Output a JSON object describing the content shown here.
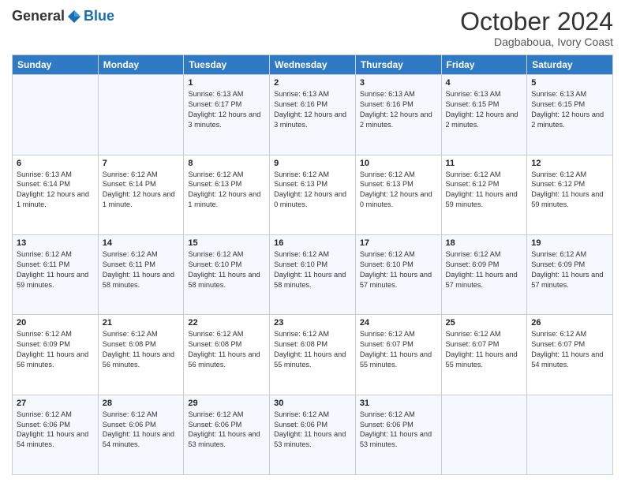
{
  "logo": {
    "general": "General",
    "blue": "Blue"
  },
  "header": {
    "month": "October 2024",
    "location": "Dagbaboua, Ivory Coast"
  },
  "days_of_week": [
    "Sunday",
    "Monday",
    "Tuesday",
    "Wednesday",
    "Thursday",
    "Friday",
    "Saturday"
  ],
  "weeks": [
    [
      {
        "day": "",
        "sunrise": "",
        "sunset": "",
        "daylight": ""
      },
      {
        "day": "",
        "sunrise": "",
        "sunset": "",
        "daylight": ""
      },
      {
        "day": "1",
        "sunrise": "Sunrise: 6:13 AM",
        "sunset": "Sunset: 6:17 PM",
        "daylight": "Daylight: 12 hours and 3 minutes."
      },
      {
        "day": "2",
        "sunrise": "Sunrise: 6:13 AM",
        "sunset": "Sunset: 6:16 PM",
        "daylight": "Daylight: 12 hours and 3 minutes."
      },
      {
        "day": "3",
        "sunrise": "Sunrise: 6:13 AM",
        "sunset": "Sunset: 6:16 PM",
        "daylight": "Daylight: 12 hours and 2 minutes."
      },
      {
        "day": "4",
        "sunrise": "Sunrise: 6:13 AM",
        "sunset": "Sunset: 6:15 PM",
        "daylight": "Daylight: 12 hours and 2 minutes."
      },
      {
        "day": "5",
        "sunrise": "Sunrise: 6:13 AM",
        "sunset": "Sunset: 6:15 PM",
        "daylight": "Daylight: 12 hours and 2 minutes."
      }
    ],
    [
      {
        "day": "6",
        "sunrise": "Sunrise: 6:13 AM",
        "sunset": "Sunset: 6:14 PM",
        "daylight": "Daylight: 12 hours and 1 minute."
      },
      {
        "day": "7",
        "sunrise": "Sunrise: 6:12 AM",
        "sunset": "Sunset: 6:14 PM",
        "daylight": "Daylight: 12 hours and 1 minute."
      },
      {
        "day": "8",
        "sunrise": "Sunrise: 6:12 AM",
        "sunset": "Sunset: 6:13 PM",
        "daylight": "Daylight: 12 hours and 1 minute."
      },
      {
        "day": "9",
        "sunrise": "Sunrise: 6:12 AM",
        "sunset": "Sunset: 6:13 PM",
        "daylight": "Daylight: 12 hours and 0 minutes."
      },
      {
        "day": "10",
        "sunrise": "Sunrise: 6:12 AM",
        "sunset": "Sunset: 6:13 PM",
        "daylight": "Daylight: 12 hours and 0 minutes."
      },
      {
        "day": "11",
        "sunrise": "Sunrise: 6:12 AM",
        "sunset": "Sunset: 6:12 PM",
        "daylight": "Daylight: 11 hours and 59 minutes."
      },
      {
        "day": "12",
        "sunrise": "Sunrise: 6:12 AM",
        "sunset": "Sunset: 6:12 PM",
        "daylight": "Daylight: 11 hours and 59 minutes."
      }
    ],
    [
      {
        "day": "13",
        "sunrise": "Sunrise: 6:12 AM",
        "sunset": "Sunset: 6:11 PM",
        "daylight": "Daylight: 11 hours and 59 minutes."
      },
      {
        "day": "14",
        "sunrise": "Sunrise: 6:12 AM",
        "sunset": "Sunset: 6:11 PM",
        "daylight": "Daylight: 11 hours and 58 minutes."
      },
      {
        "day": "15",
        "sunrise": "Sunrise: 6:12 AM",
        "sunset": "Sunset: 6:10 PM",
        "daylight": "Daylight: 11 hours and 58 minutes."
      },
      {
        "day": "16",
        "sunrise": "Sunrise: 6:12 AM",
        "sunset": "Sunset: 6:10 PM",
        "daylight": "Daylight: 11 hours and 58 minutes."
      },
      {
        "day": "17",
        "sunrise": "Sunrise: 6:12 AM",
        "sunset": "Sunset: 6:10 PM",
        "daylight": "Daylight: 11 hours and 57 minutes."
      },
      {
        "day": "18",
        "sunrise": "Sunrise: 6:12 AM",
        "sunset": "Sunset: 6:09 PM",
        "daylight": "Daylight: 11 hours and 57 minutes."
      },
      {
        "day": "19",
        "sunrise": "Sunrise: 6:12 AM",
        "sunset": "Sunset: 6:09 PM",
        "daylight": "Daylight: 11 hours and 57 minutes."
      }
    ],
    [
      {
        "day": "20",
        "sunrise": "Sunrise: 6:12 AM",
        "sunset": "Sunset: 6:09 PM",
        "daylight": "Daylight: 11 hours and 56 minutes."
      },
      {
        "day": "21",
        "sunrise": "Sunrise: 6:12 AM",
        "sunset": "Sunset: 6:08 PM",
        "daylight": "Daylight: 11 hours and 56 minutes."
      },
      {
        "day": "22",
        "sunrise": "Sunrise: 6:12 AM",
        "sunset": "Sunset: 6:08 PM",
        "daylight": "Daylight: 11 hours and 56 minutes."
      },
      {
        "day": "23",
        "sunrise": "Sunrise: 6:12 AM",
        "sunset": "Sunset: 6:08 PM",
        "daylight": "Daylight: 11 hours and 55 minutes."
      },
      {
        "day": "24",
        "sunrise": "Sunrise: 6:12 AM",
        "sunset": "Sunset: 6:07 PM",
        "daylight": "Daylight: 11 hours and 55 minutes."
      },
      {
        "day": "25",
        "sunrise": "Sunrise: 6:12 AM",
        "sunset": "Sunset: 6:07 PM",
        "daylight": "Daylight: 11 hours and 55 minutes."
      },
      {
        "day": "26",
        "sunrise": "Sunrise: 6:12 AM",
        "sunset": "Sunset: 6:07 PM",
        "daylight": "Daylight: 11 hours and 54 minutes."
      }
    ],
    [
      {
        "day": "27",
        "sunrise": "Sunrise: 6:12 AM",
        "sunset": "Sunset: 6:06 PM",
        "daylight": "Daylight: 11 hours and 54 minutes."
      },
      {
        "day": "28",
        "sunrise": "Sunrise: 6:12 AM",
        "sunset": "Sunset: 6:06 PM",
        "daylight": "Daylight: 11 hours and 54 minutes."
      },
      {
        "day": "29",
        "sunrise": "Sunrise: 6:12 AM",
        "sunset": "Sunset: 6:06 PM",
        "daylight": "Daylight: 11 hours and 53 minutes."
      },
      {
        "day": "30",
        "sunrise": "Sunrise: 6:12 AM",
        "sunset": "Sunset: 6:06 PM",
        "daylight": "Daylight: 11 hours and 53 minutes."
      },
      {
        "day": "31",
        "sunrise": "Sunrise: 6:12 AM",
        "sunset": "Sunset: 6:06 PM",
        "daylight": "Daylight: 11 hours and 53 minutes."
      },
      {
        "day": "",
        "sunrise": "",
        "sunset": "",
        "daylight": ""
      },
      {
        "day": "",
        "sunrise": "",
        "sunset": "",
        "daylight": ""
      }
    ]
  ]
}
